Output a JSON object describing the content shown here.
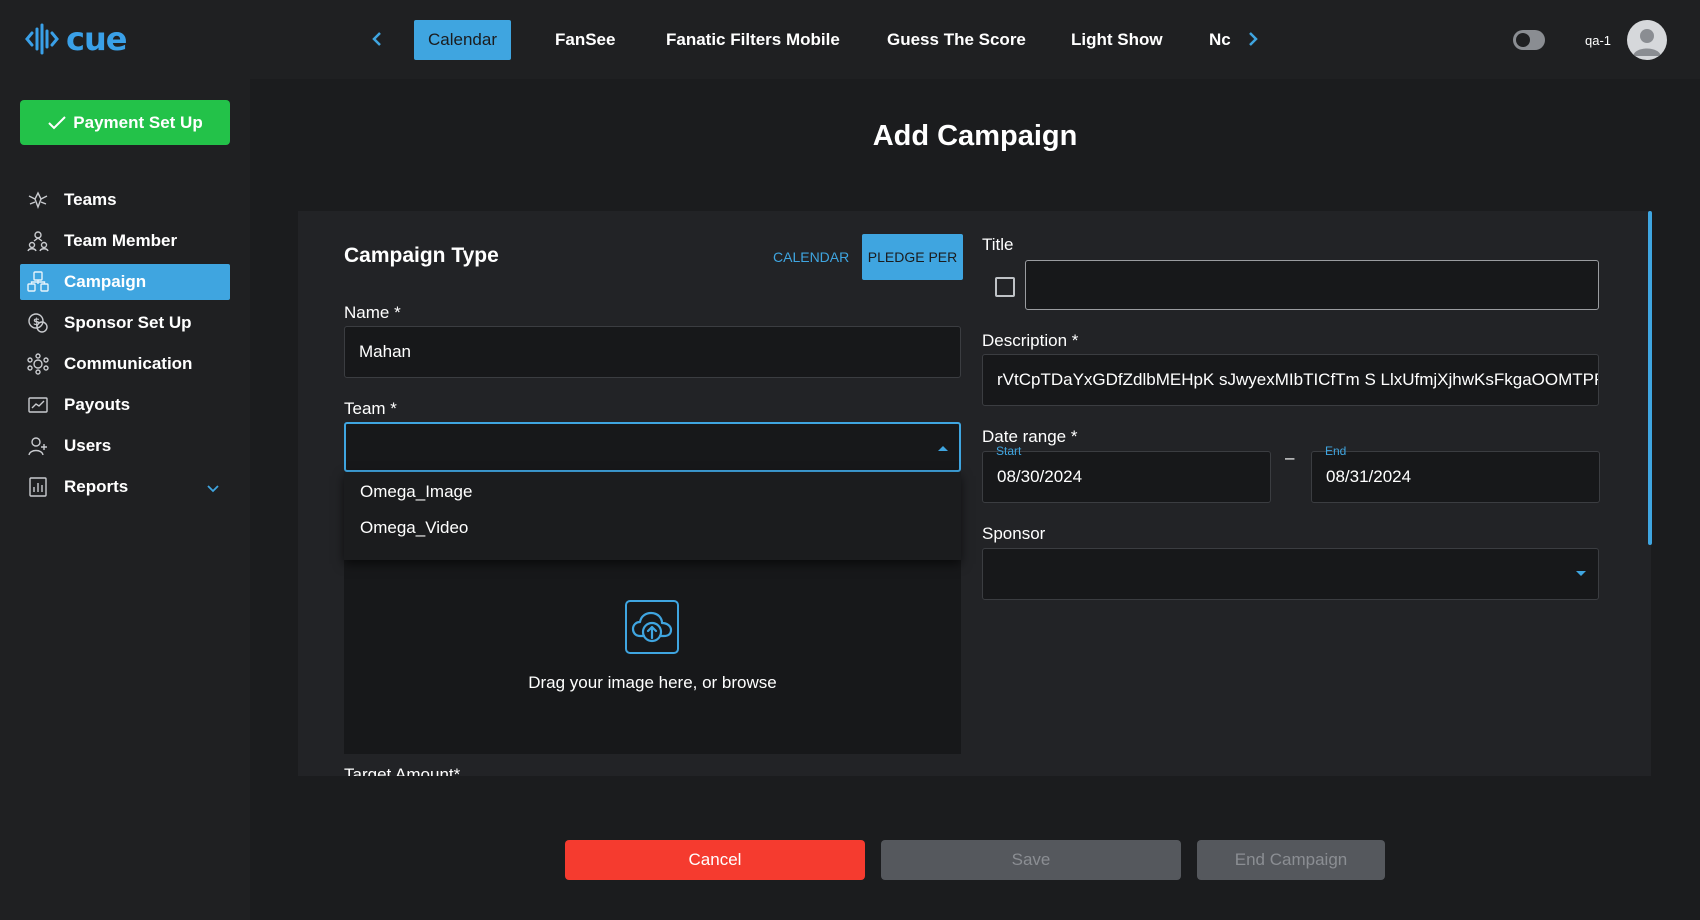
{
  "brand": {
    "name": "cue",
    "accent": "#3fa5e0",
    "success": "#23c249",
    "danger": "#f53b2f"
  },
  "topnav": {
    "tabs": [
      "Calendar",
      "FanSee",
      "Fanatic Filters Mobile",
      "Guess The Score",
      "Light Show",
      "Nc"
    ],
    "active_tab": "Calendar",
    "username": "qa-1",
    "icons": {
      "prev": "chevron-left-icon",
      "next": "chevron-right-icon",
      "theme": "theme-toggle-icon",
      "avatar": "user-avatar-icon"
    }
  },
  "sidebar": {
    "payment_button": "Payment Set Up",
    "items": [
      {
        "label": "Teams",
        "icon": "teams-icon"
      },
      {
        "label": "Team Member",
        "icon": "team-member-icon"
      },
      {
        "label": "Campaign",
        "icon": "campaign-icon",
        "active": true
      },
      {
        "label": "Sponsor Set Up",
        "icon": "sponsor-icon"
      },
      {
        "label": "Communication",
        "icon": "communication-icon"
      },
      {
        "label": "Payouts",
        "icon": "payouts-icon"
      },
      {
        "label": "Users",
        "icon": "users-icon"
      },
      {
        "label": "Reports",
        "icon": "reports-icon",
        "expandable": true
      }
    ]
  },
  "main": {
    "title": "Add Campaign",
    "campaign_type": {
      "heading": "Campaign Type",
      "options": [
        "CALENDAR",
        "PLEDGE PER"
      ],
      "selected": "PLEDGE PER"
    },
    "name": {
      "label": "Name *",
      "value": "Mahan"
    },
    "team": {
      "label": "Team *",
      "value": "",
      "options": [
        "Omega_Image",
        "Omega_Video"
      ]
    },
    "upload": {
      "text": "Drag your image here, or browse"
    },
    "target_amount_label": "Target Amount*",
    "title_field": {
      "label": "Title",
      "value": "",
      "checked": false
    },
    "description": {
      "label": "Description *",
      "value": "rVtCpTDaYxGDfZdlbMEHpK sJwyexMIbTICfTm S LlxUfmjXjhwKsFkgaOOMTPFc"
    },
    "date_range": {
      "label": "Date range *",
      "start_label": "Start",
      "start": "08/30/2024",
      "separator": "–",
      "end_label": "End",
      "end": "08/31/2024"
    },
    "sponsor": {
      "label": "Sponsor",
      "value": ""
    }
  },
  "actions": {
    "cancel": "Cancel",
    "save": "Save",
    "end": "End Campaign"
  }
}
